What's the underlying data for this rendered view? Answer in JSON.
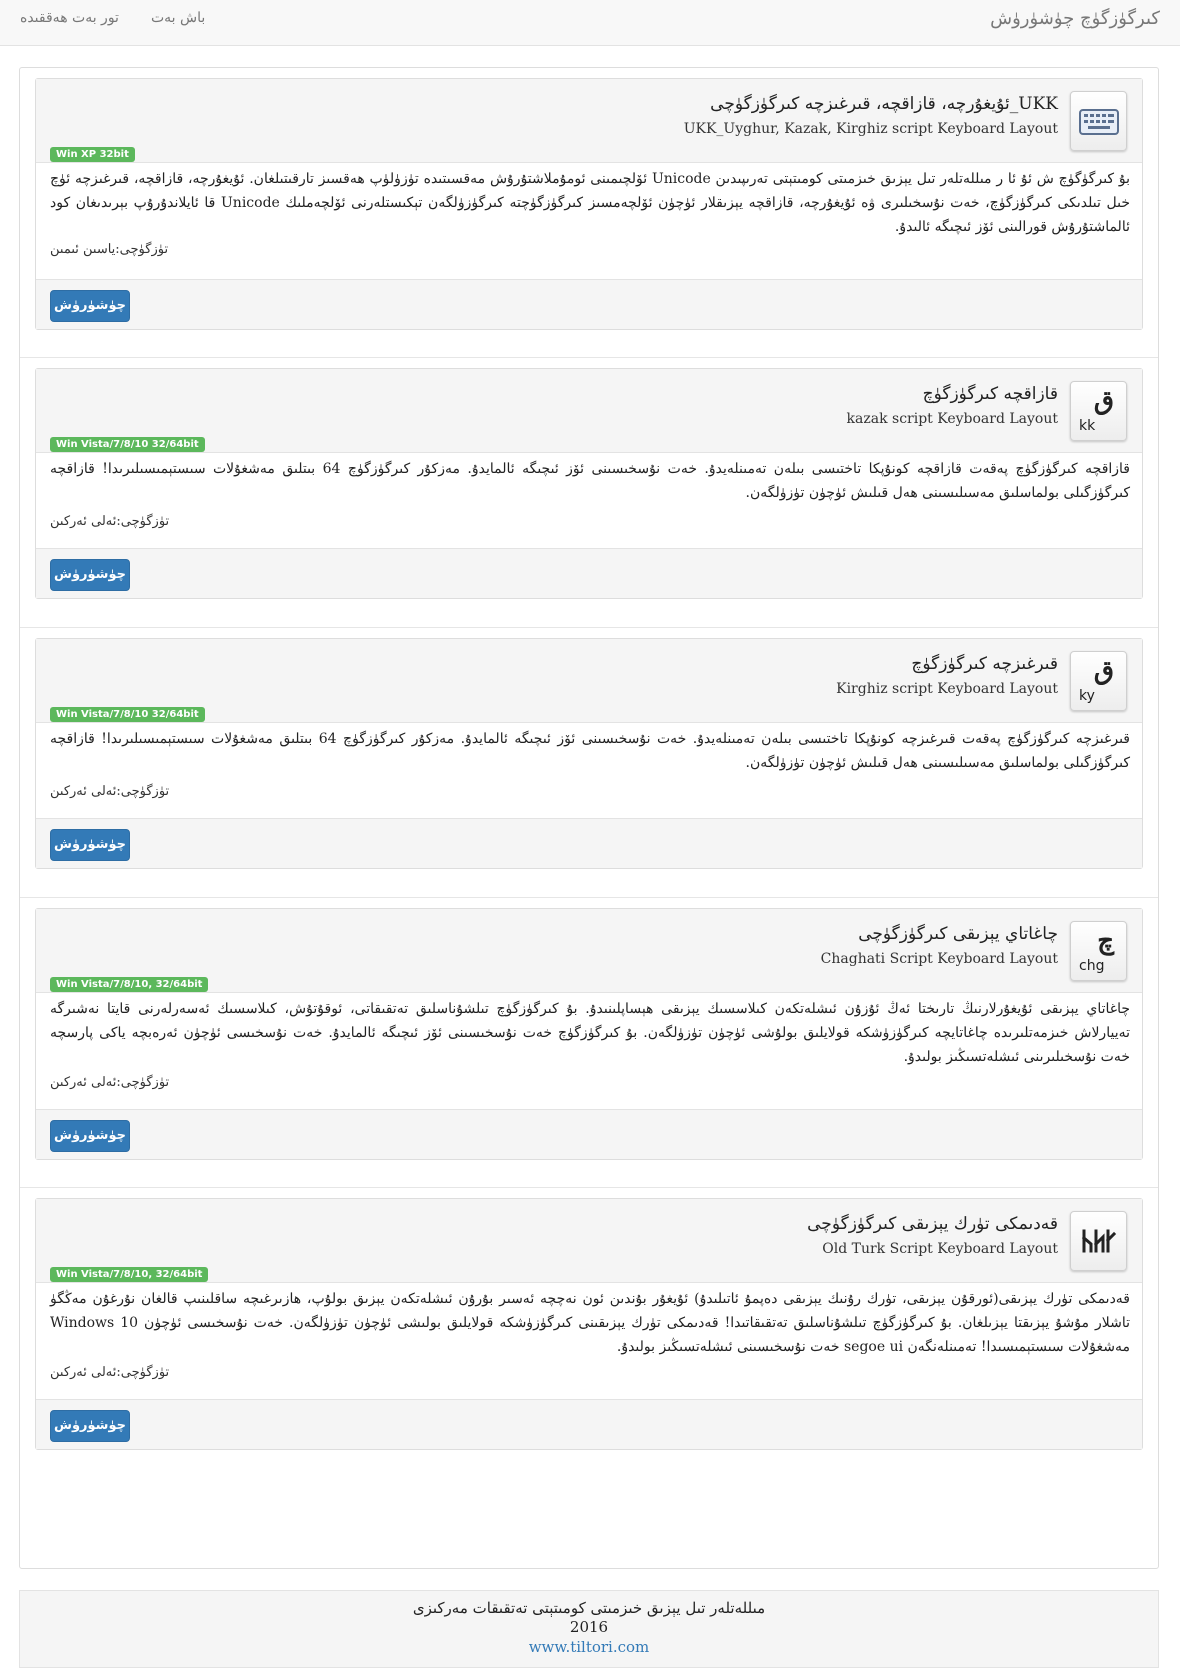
{
  "navbar": {
    "brand": "كىرگۈزگۈچ چۈشۈرۈش",
    "links": [
      "باش بەت",
      "تور بەت ھەققىدە"
    ]
  },
  "download_label": "چۈشۈرۈش",
  "cards": [
    {
      "title": "UKK_ئۇيغۇرچە، قازاقچە، قىرغىزچە كىرگۈزگۈچى",
      "subtitle": "UKK_Uyghur, Kazak,  Kirghiz script Keyboard Layout",
      "badge": "Win XP 32bit",
      "icon": "keyboard-icon",
      "description": "بۇ كىرگۈگۈچ ش ئۇ ئا ر مىللەتلەر تىل يېزىق خىزمىتى كومىتېتى تەرىپىدىن Unicode ئۆلچىمىنى ئومۇملاشتۇرۇش مەقسىتىدە تۈزۈلۈپ ھەقسىز تارقىتىلغان. ئۇيغۇرچە، قازاقچە، قىرغىزچە ئۈچ خىل تىلدىكى كىرگۈزگۈچ، خەت نۇسخىلىرى ۋە ئۇيغۇرچە، قازاقچە يېزىقلار ئۈچۈن ئۆلچەمسىز كىرگۈزگۈچتە كىرگۈزۈلگەن تېكىستلەرنى ئۆلچەملىك Unicode قا ئايلاندۇرۇپ بېرىدىغان كود ئالماشتۇرۇش قورالىنى ئۆز ئىچىگە ئالىدۇ.",
      "author": "تۈزگۈچى:ياسىن ئىمىن"
    },
    {
      "title": "قازاقچە كىرگۈزگۈچ",
      "subtitle": "kazak script Keyboard Layout",
      "badge": "Win Vista/7/8/10 32/64bit",
      "icon_letter": "ق",
      "icon_code": "kk",
      "description": "قازاقچە كىرگۈزگۈچ پەقەت قازاقچە كونۇپكا تاختىسى بىلەن تەمىنلەيدۇ. خەت نۇسخىسىنى ئۆز ئىچىگە ئالمايدۇ. مەزكۇر كىرگۈزگۈچ 64 بىتلىق مەشغۇلات سىستېمىسىلىرىدا! قازاقچە كىرگۈزگىلى بولماسلىق مەسىلىسىنى ھەل قىلىش ئۈچۈن تۈزۈلگەن.",
      "author": "تۈزگۈچى:ئەلى ئەركىن"
    },
    {
      "title": "قىرغىزچە كىرگۈزگۈچ",
      "subtitle": "Kirghiz script Keyboard Layout",
      "badge": "Win Vista/7/8/10 32/64bit",
      "icon_letter": "ق",
      "icon_code": "ky",
      "description": "قىرغىزچە كىرگۈزگۈچ پەقەت قىرغىزچە كونۇپكا تاختىسى بىلەن تەمىنلەيدۇ. خەت نۇسخىسىنى ئۆز ئىچىگە ئالمايدۇ. مەزكۇر كىرگۈزگۈچ 64 بىتلىق مەشغۇلات سىستېمىسىلىرىدا! قازاقچە كىرگۈزگىلى بولماسلىق مەسىلىسىنى ھەل قىلىش ئۈچۈن تۈزۈلگەن.",
      "author": "تۈزگۈچى:ئەلى ئەركىن"
    },
    {
      "title": "چاغاتاي يېزىقى كىرگۈزگۈچى",
      "subtitle": "Chaghati Script Keyboard Layout",
      "badge": "Win Vista/7/8/10, 32/64bit",
      "icon_letter": "چ",
      "icon_code": "chg",
      "description": "چاغاتاي يېزىقى ئۇيغۇرلارنىڭ تارىختا ئەڭ ئۇزۇن ئىشلەتكەن كىلاسسىك يېزىقى ھېساپلىنىدۇ. بۇ كىرگۈزگۈچ تىلشۇناسلىق تەتقىقاتى، ئوقۇتۇش، كىلاسسىك ئەسەرلەرنى قايتا نەشىرگە تەييارلاش خىزمەتلىرىدە چاغاتايچە كىرگۈزۈشكە قولايلىق بولۇشى ئۈچۈن تۈزۈلگەن. بۇ كىرگۈزگۈچ خەت نۇسخىسىنى ئۆز ئىچىگە ئالمايدۇ. خەت نۇسخىسى ئۈچۈن ئەرەبچە ياكى پارسچە خەت نۇسخىلىرىنى ئىشلەتسىڭىز بولىدۇ.",
      "author": "تۈزگۈچى:ئەلى ئەركىن"
    },
    {
      "title": "قەدىمكى تۈرك يېزىقى كىرگۈزگۈچى",
      "subtitle": "Old Turk Script Keyboard Layout",
      "badge": "Win Vista/7/8/10, 32/64bit",
      "icon": "old-turk-icon",
      "description": "قەدىمكى تۈرك يېزىقى(ئورقۇن يېزىقى، تۈرك رۇنىك يېزىقى دەپمۇ ئاتىلىدۇ) ئۇيغۇر بۇندىن ئون نەچچە ئەسىر بۇرۇن ئىشلەتكەن يېزىق بولۇپ، ھازىرغىچە ساقلىنىپ قالغان نۇرغۇن مەڭگۈ تاشلار مۇشۇ يېزىقتا يېزىلغان. بۇ كىرگۈزگۈچ تىلشۇناسلىق تەتقىقاتىدا! قەدىمكى تۈرك يېزىقىنى كىرگۈزۈشكە قولايلىق بولىشى ئۈچۈن تۈزۈلگەن. خەت نۇسخىسى ئۈچۈن Windows 10 مەشغۇلات سىستېمىسىدا! تەمىنلەنگەن segoe ui خەت نۇسخىسىنى ئىشلەتسىڭىز بولىدۇ.",
      "author": "تۈزگۈچى:ئەلى ئەركىن"
    }
  ],
  "footer": {
    "org": "مىللەتلەر تىل يېزىق خىزمىتى كومىتېتى تەتقىقات مەركىزى",
    "year": "2016",
    "site": "www.tiltori.com"
  }
}
